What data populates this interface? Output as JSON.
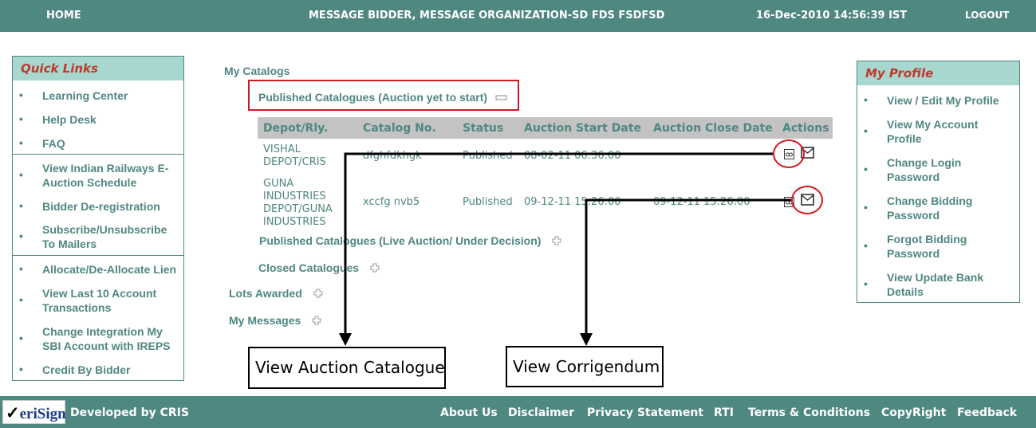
{
  "header": {
    "home": "HOME",
    "message": "MESSAGE BIDDER, MESSAGE ORGANIZATION-SD FDS FSDFSD",
    "datetime": "16-Dec-2010 14:56:39 IST",
    "logout": "LOGOUT"
  },
  "quick_links": {
    "title": "Quick Links",
    "items": [
      "Learning Center",
      "Help Desk",
      "FAQ",
      "View Indian Railways E-Auction Schedule",
      "Bidder De-registration",
      "Subscribe/Unsubscribe To Mailers",
      "Allocate/De-Allocate Lien",
      "View Last 10 Account Transactions",
      "Change Integration My SBI Account with IREPS",
      "Credit By Bidder"
    ]
  },
  "main": {
    "my_catalogs": "My Catalogs",
    "published_yet": "Published Catalogues (Auction yet to start)",
    "published_live": "Published Catalogues (Live Auction/ Under Decision)",
    "closed": "Closed Catalogues",
    "lots_awarded": "Lots Awarded",
    "my_messages": "My Messages",
    "table": {
      "headers": [
        "Depot/Rly.",
        "Catalog No.",
        "Status",
        "Auction Start Date",
        "Auction Close Date",
        "Actions"
      ],
      "rows": [
        [
          "VISHAL DEPOT/CRIS",
          "dfghfdkhgk",
          "Published",
          "08-02-11 06:36:00",
          ""
        ],
        [
          "GUNA INDUSTRIES DEPOT/GUNA INDUSTRIES",
          "xccfg nvb5",
          "Published",
          "09-12-11 15:26:00",
          "09-12-11 15:26:00"
        ]
      ]
    }
  },
  "my_profile": {
    "title": "My Profile",
    "items": [
      "View / Edit My Profile",
      "View My Account Profile",
      "Change Login Password",
      "Change Bidding Password",
      "Forgot Bidding Password",
      "View Update Bank Details"
    ]
  },
  "callouts": {
    "view_catalogue": "View Auction Catalogue",
    "view_corrigendum": "View Corrigendum"
  },
  "footer": {
    "verisign": "VeriSign",
    "developed_by": "Developed by CRIS",
    "links": [
      "About Us",
      "Disclaimer",
      "Privacy Statement",
      "RTI",
      "Terms & Conditions",
      "CopyRight",
      "Feedback"
    ]
  },
  "colors": {
    "theme": "#4f8781",
    "panel_header": "#a7d7cf",
    "highlight": "#d0191f"
  }
}
